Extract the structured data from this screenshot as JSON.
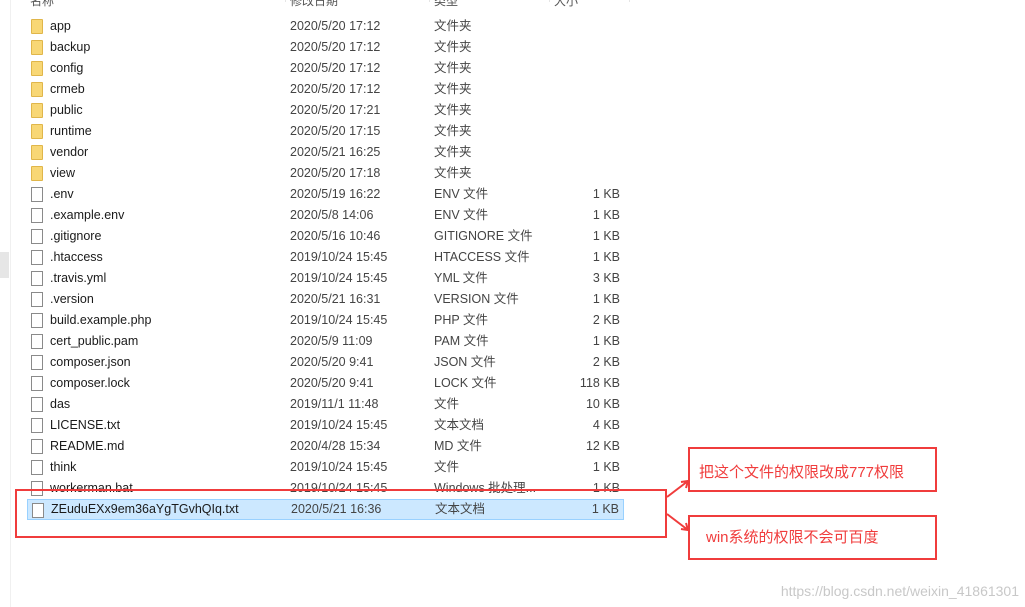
{
  "header": {
    "columns": [
      "名称",
      "修改日期",
      "类型",
      "大小"
    ]
  },
  "files": [
    {
      "name": "app",
      "date": "2020/5/20 17:12",
      "type": "文件夹",
      "size": "",
      "icon": "folder-icon"
    },
    {
      "name": "backup",
      "date": "2020/5/20 17:12",
      "type": "文件夹",
      "size": "",
      "icon": "folder-icon"
    },
    {
      "name": "config",
      "date": "2020/5/20 17:12",
      "type": "文件夹",
      "size": "",
      "icon": "folder-icon"
    },
    {
      "name": "crmeb",
      "date": "2020/5/20 17:12",
      "type": "文件夹",
      "size": "",
      "icon": "folder-icon"
    },
    {
      "name": "public",
      "date": "2020/5/20 17:21",
      "type": "文件夹",
      "size": "",
      "icon": "folder-icon"
    },
    {
      "name": "runtime",
      "date": "2020/5/20 17:15",
      "type": "文件夹",
      "size": "",
      "icon": "folder-icon"
    },
    {
      "name": "vendor",
      "date": "2020/5/21 16:25",
      "type": "文件夹",
      "size": "",
      "icon": "folder-icon"
    },
    {
      "name": "view",
      "date": "2020/5/20 17:18",
      "type": "文件夹",
      "size": "",
      "icon": "folder-icon"
    },
    {
      "name": ".env",
      "date": "2020/5/19 16:22",
      "type": "ENV 文件",
      "size": "1 KB",
      "icon": "file-icon"
    },
    {
      "name": ".example.env",
      "date": "2020/5/8 14:06",
      "type": "ENV 文件",
      "size": "1 KB",
      "icon": "file-icon"
    },
    {
      "name": ".gitignore",
      "date": "2020/5/16 10:46",
      "type": "GITIGNORE 文件",
      "size": "1 KB",
      "icon": "file-icon"
    },
    {
      "name": ".htaccess",
      "date": "2019/10/24 15:45",
      "type": "HTACCESS 文件",
      "size": "1 KB",
      "icon": "file-icon"
    },
    {
      "name": ".travis.yml",
      "date": "2019/10/24 15:45",
      "type": "YML 文件",
      "size": "3 KB",
      "icon": "file-icon"
    },
    {
      "name": ".version",
      "date": "2020/5/21 16:31",
      "type": "VERSION 文件",
      "size": "1 KB",
      "icon": "file-icon"
    },
    {
      "name": "build.example.php",
      "date": "2019/10/24 15:45",
      "type": "PHP 文件",
      "size": "2 KB",
      "icon": "file-icon"
    },
    {
      "name": "cert_public.pam",
      "date": "2020/5/9 11:09",
      "type": "PAM 文件",
      "size": "1 KB",
      "icon": "file-icon"
    },
    {
      "name": "composer.json",
      "date": "2020/5/20 9:41",
      "type": "JSON 文件",
      "size": "2 KB",
      "icon": "file-icon"
    },
    {
      "name": "composer.lock",
      "date": "2020/5/20 9:41",
      "type": "LOCK 文件",
      "size": "118 KB",
      "icon": "file-icon"
    },
    {
      "name": "das",
      "date": "2019/11/1 11:48",
      "type": "文件",
      "size": "10 KB",
      "icon": "file-icon"
    },
    {
      "name": "LICENSE.txt",
      "date": "2019/10/24 15:45",
      "type": "文本文档",
      "size": "4 KB",
      "icon": "text-file-icon"
    },
    {
      "name": "README.md",
      "date": "2020/4/28 15:34",
      "type": "MD 文件",
      "size": "12 KB",
      "icon": "file-icon"
    },
    {
      "name": "think",
      "date": "2019/10/24 15:45",
      "type": "文件",
      "size": "1 KB",
      "icon": "file-icon"
    },
    {
      "name": "workerman.bat",
      "date": "2019/10/24 15:45",
      "type": "Windows 批处理...",
      "size": "1 KB",
      "icon": "batch-file-icon"
    },
    {
      "name": "ZEuduEXx9em36aYgTGvhQIq.txt",
      "date": "2020/5/21 16:36",
      "type": "文本文档",
      "size": "1 KB",
      "icon": "text-file-icon",
      "selected": true
    }
  ],
  "annotations": {
    "note1": "把这个文件的权限改成777权限",
    "note2": "win系统的权限不会可百度",
    "color": "#f03c3c"
  },
  "watermark": "https://blog.csdn.net/weixin_41861301"
}
